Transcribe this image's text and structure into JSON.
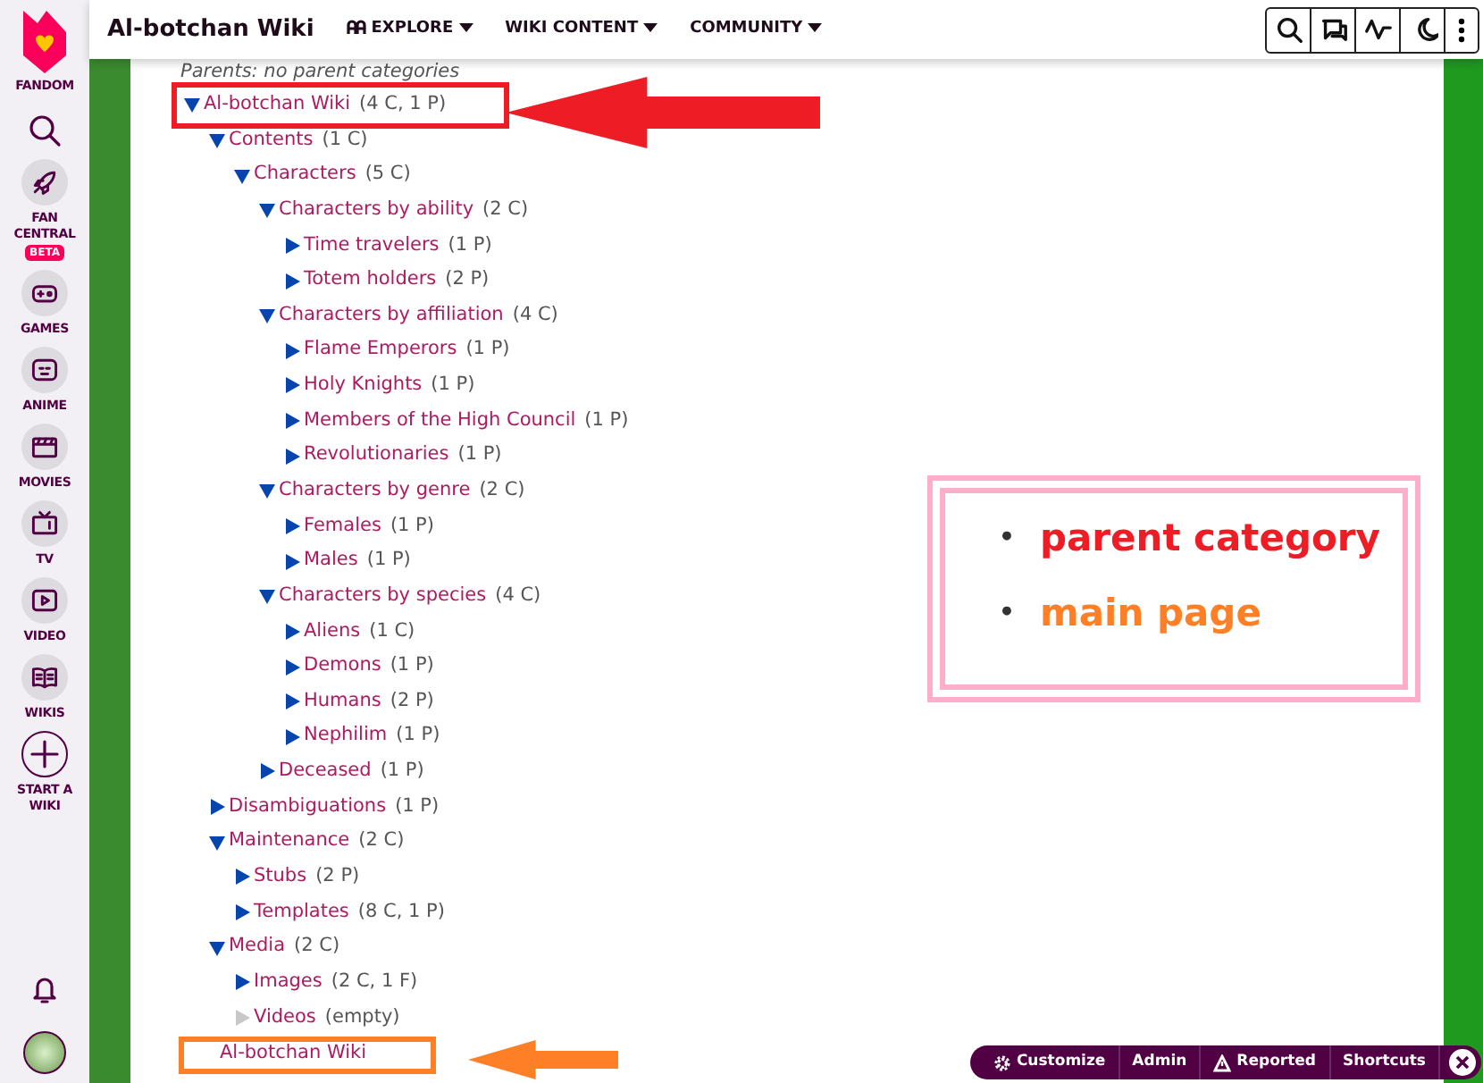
{
  "rail": {
    "brand": "FANDOM",
    "items": [
      {
        "kind": "rocket",
        "label": "FAN CENTRAL",
        "badge": "BETA"
      },
      {
        "kind": "gamepad",
        "label": "GAMES"
      },
      {
        "kind": "anime",
        "label": "ANIME"
      },
      {
        "kind": "clapper",
        "label": "MOVIES"
      },
      {
        "kind": "tv",
        "label": "TV"
      },
      {
        "kind": "play",
        "label": "VIDEO"
      },
      {
        "kind": "book",
        "label": "WIKIS"
      },
      {
        "kind": "plus",
        "label": "START A WIKI"
      }
    ]
  },
  "header": {
    "title": "Al-botchan Wiki",
    "nav": [
      {
        "label": "EXPLORE",
        "icon": true
      },
      {
        "label": "WIKI CONTENT",
        "icon": false
      },
      {
        "label": "COMMUNITY",
        "icon": false
      }
    ]
  },
  "parents_text": "Parents: no parent categories",
  "tree": [
    {
      "label": "Al-botchan Wiki",
      "count": "(4 C, 1 P)",
      "expanded": true,
      "empty": false,
      "color": "#ee1c24",
      "children": [
        {
          "label": "Contents",
          "count": "(1 C)",
          "expanded": true,
          "empty": false,
          "children": [
            {
              "label": "Characters",
              "count": "(5 C)",
              "expanded": true,
              "empty": false,
              "children": [
                {
                  "label": "Characters by ability",
                  "count": "(2 C)",
                  "expanded": true,
                  "empty": false,
                  "children": [
                    {
                      "label": "Time travelers",
                      "count": "(1 P)",
                      "expanded": false,
                      "empty": false
                    },
                    {
                      "label": "Totem holders",
                      "count": "(2 P)",
                      "expanded": false,
                      "empty": false
                    }
                  ]
                },
                {
                  "label": "Characters by affiliation",
                  "count": "(4 C)",
                  "expanded": true,
                  "empty": false,
                  "children": [
                    {
                      "label": "Flame Emperors",
                      "count": "(1 P)",
                      "expanded": false,
                      "empty": false
                    },
                    {
                      "label": "Holy Knights",
                      "count": "(1 P)",
                      "expanded": false,
                      "empty": false
                    },
                    {
                      "label": "Members of the High Council",
                      "count": "(1 P)",
                      "expanded": false,
                      "empty": false
                    },
                    {
                      "label": "Revolutionaries",
                      "count": "(1 P)",
                      "expanded": false,
                      "empty": false
                    }
                  ]
                },
                {
                  "label": "Characters by genre",
                  "count": "(2 C)",
                  "expanded": true,
                  "empty": false,
                  "children": [
                    {
                      "label": "Females",
                      "count": "(1 P)",
                      "expanded": false,
                      "empty": false
                    },
                    {
                      "label": "Males",
                      "count": "(1 P)",
                      "expanded": false,
                      "empty": false
                    }
                  ]
                },
                {
                  "label": "Characters by species",
                  "count": "(4 C)",
                  "expanded": true,
                  "empty": false,
                  "children": [
                    {
                      "label": "Aliens",
                      "count": "(1 C)",
                      "expanded": false,
                      "empty": false
                    },
                    {
                      "label": "Demons",
                      "count": "(1 P)",
                      "expanded": false,
                      "empty": false
                    },
                    {
                      "label": "Humans",
                      "count": "(2 P)",
                      "expanded": false,
                      "empty": false
                    },
                    {
                      "label": "Nephilim",
                      "count": "(1 P)",
                      "expanded": false,
                      "empty": false
                    }
                  ]
                },
                {
                  "label": "Deceased",
                  "count": "(1 P)",
                  "expanded": false,
                  "empty": false
                }
              ]
            }
          ]
        },
        {
          "label": "Disambiguations",
          "count": "(1 P)",
          "expanded": false,
          "empty": false
        },
        {
          "label": "Maintenance",
          "count": "(2 C)",
          "expanded": true,
          "empty": false,
          "children": [
            {
              "label": "Stubs",
              "count": "(2 P)",
              "expanded": false,
              "empty": false
            },
            {
              "label": "Templates",
              "count": "(8 C, 1 P)",
              "expanded": false,
              "empty": false
            }
          ]
        },
        {
          "label": "Media",
          "count": "(2 C)",
          "expanded": true,
          "empty": false,
          "children": [
            {
              "label": "Images",
              "count": "(2 C, 1 F)",
              "expanded": false,
              "empty": false
            },
            {
              "label": "Videos",
              "count": "(empty)",
              "expanded": false,
              "empty": true
            }
          ]
        }
      ]
    }
  ],
  "main_page_link": {
    "label": "Al-botchan Wiki",
    "color": "#ff7f27"
  },
  "legend": {
    "color": "#ffaec9",
    "items": [
      {
        "marker": "•",
        "label": "parent category",
        "color": "#ee1c24"
      },
      {
        "marker": "•",
        "label": "main page",
        "color": "#ff7f27"
      }
    ]
  },
  "admin_bar": [
    {
      "label": "Customize",
      "kind": "gear"
    },
    {
      "label": "Admin",
      "kind": "none"
    },
    {
      "label": "Reported",
      "kind": "warning"
    },
    {
      "label": "Shortcuts",
      "kind": "none"
    }
  ]
}
